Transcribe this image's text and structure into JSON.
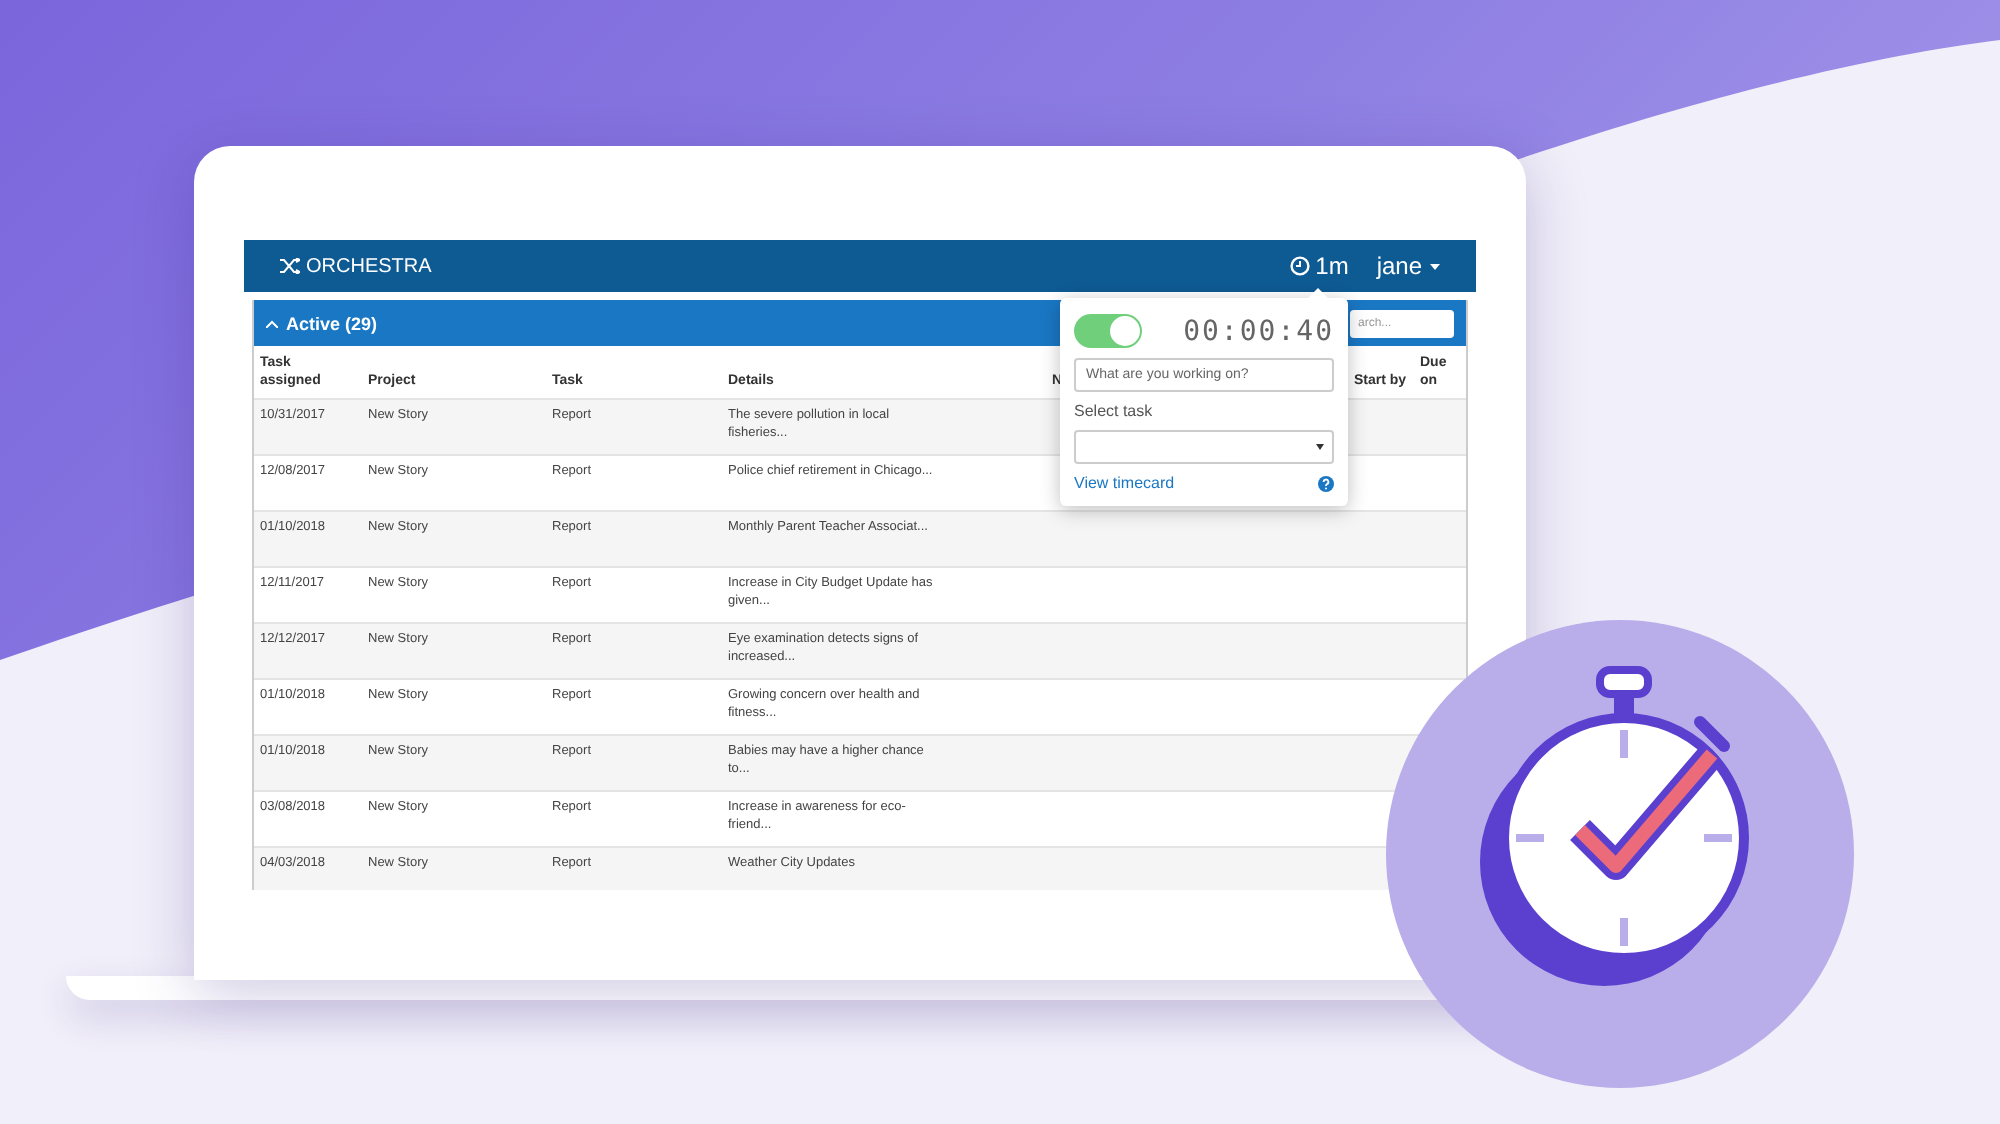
{
  "app": {
    "logo": "ORCHESTRA",
    "timer_badge": "1m",
    "user": "jane"
  },
  "panel": {
    "title": "Active (29)",
    "expanded": true,
    "search": {
      "placeholder": "arch..."
    }
  },
  "table": {
    "columns": [
      "Task assigned",
      "Project",
      "Task",
      "Details",
      "N",
      "Start by",
      "Due on"
    ],
    "rows": [
      {
        "date": "10/31/2017",
        "project": "New Story",
        "task": "Report",
        "details": "The severe pollution in local fisheries..."
      },
      {
        "date": "12/08/2017",
        "project": "New Story",
        "task": "Report",
        "details": "Police chief retirement in Chicago..."
      },
      {
        "date": "01/10/2018",
        "project": "New Story",
        "task": "Report",
        "details": "Monthly Parent Teacher Associat..."
      },
      {
        "date": "12/11/2017",
        "project": "New Story",
        "task": "Report",
        "details": "Increase in City Budget Update has given..."
      },
      {
        "date": "12/12/2017",
        "project": "New Story",
        "task": "Report",
        "details": "Eye examination detects signs of increased..."
      },
      {
        "date": "01/10/2018",
        "project": "New Story",
        "task": "Report",
        "details": "Growing concern over health and fitness..."
      },
      {
        "date": "01/10/2018",
        "project": "New Story",
        "task": "Report",
        "details": "Babies may have a higher chance to..."
      },
      {
        "date": "03/08/2018",
        "project": "New Story",
        "task": "Report",
        "details": "Increase in awareness for eco-friend..."
      },
      {
        "date": "04/03/2018",
        "project": "New Story",
        "task": "Report",
        "details": "Weather City Updates"
      }
    ]
  },
  "timer_popover": {
    "running": true,
    "time": "00:00:40",
    "note": {
      "placeholder": "What are you working on?"
    },
    "select_label": "Select task",
    "link": "View timecard"
  }
}
